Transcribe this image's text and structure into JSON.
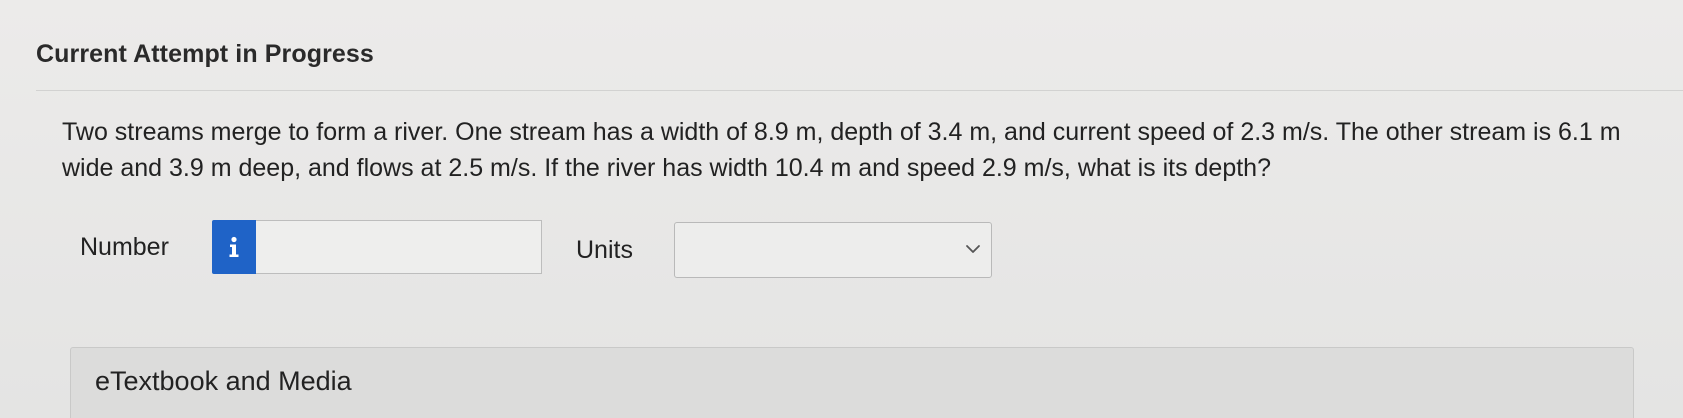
{
  "attempt": {
    "title": "Current Attempt in Progress"
  },
  "question": {
    "text": "Two streams merge to form a river. One stream has a width of 8.9 m, depth of 3.4 m, and current speed of 2.3 m/s. The other stream is 6.1 m wide and 3.9 m deep, and flows at 2.5 m/s. If the river has width 10.4 m and speed 2.9 m/s, what is its depth?"
  },
  "answer": {
    "number_label": "Number",
    "number_value": "",
    "info_icon": "info-icon",
    "units_label": "Units",
    "units_selected": "",
    "units_icon": "chevron-down-icon"
  },
  "resources": {
    "etextbook_label": "eTextbook and Media"
  },
  "colors": {
    "info_button": "#1f63c7",
    "background": "#e6e6e5"
  }
}
